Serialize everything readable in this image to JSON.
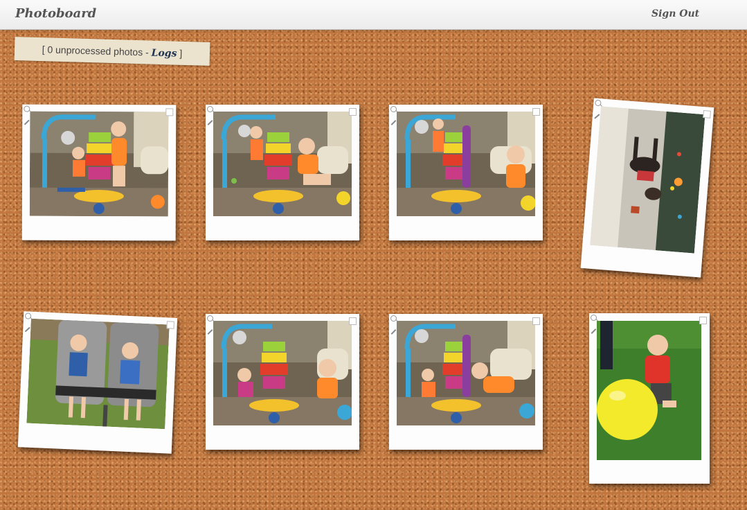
{
  "app": {
    "brand": "Photoboard",
    "sign_out_label": "Sign Out"
  },
  "status": {
    "open_bracket": "[ ",
    "count_text": "0 unprocessed photos - ",
    "logs_link": "Logs",
    "close_bracket": " ]"
  },
  "photos": [
    {
      "scene": "playroom-toy-tower",
      "orientation": "landscape",
      "caption": ""
    },
    {
      "scene": "playroom-toy-tower",
      "orientation": "landscape",
      "caption": ""
    },
    {
      "scene": "playroom-toy-tower",
      "orientation": "landscape",
      "caption": ""
    },
    {
      "scene": "dog-on-floor",
      "orientation": "portrait",
      "caption": ""
    },
    {
      "scene": "twins-in-double-stroller",
      "orientation": "landscape",
      "caption": ""
    },
    {
      "scene": "playroom-toy-tower",
      "orientation": "landscape",
      "caption": ""
    },
    {
      "scene": "playroom-toy-tower",
      "orientation": "landscape",
      "caption": ""
    },
    {
      "scene": "baby-with-yellow-ball",
      "orientation": "portrait",
      "caption": ""
    }
  ],
  "colors": {
    "cork": "#c0763e",
    "topbar": "#f5f5f5",
    "brand_text": "#555555",
    "note_paper": "#ece3cf",
    "logs_link": "#1f3450",
    "polaroid_frame": "#fdfdfd"
  },
  "icons": {
    "photo_zoom": "zoom-icon",
    "photo_edit": "pencil-icon",
    "photo_select": "checkbox"
  }
}
